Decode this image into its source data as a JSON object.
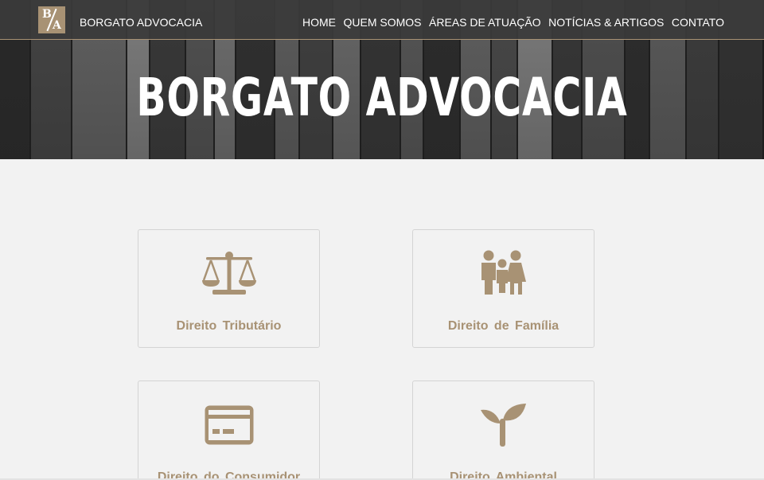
{
  "header": {
    "brand": "BORGATO ADVOCACIA",
    "logo_letters": {
      "top": "B",
      "bottom": "A"
    },
    "nav": [
      {
        "label": "HOME"
      },
      {
        "label": "QUEM SOMOS"
      },
      {
        "label": "ÁREAS DE ATUAÇÃO"
      },
      {
        "label": "NOTÍCIAS & ARTIGOS"
      },
      {
        "label": "CONTATO"
      }
    ]
  },
  "hero": {
    "title": "BORGATO ADVOCACIA"
  },
  "practice_areas": [
    {
      "label": "Direito Tributário",
      "icon": "scales-icon"
    },
    {
      "label": "Direito de Família",
      "icon": "family-icon"
    },
    {
      "label": "Direito do Consumidor",
      "icon": "credit-card-icon"
    },
    {
      "label": "Direito Ambiental",
      "icon": "sprout-icon"
    }
  ],
  "colors": {
    "accent": "#a89274",
    "navbar": "#3a3a3a",
    "background": "#f2f2f2",
    "card_border": "#d4d4d4"
  }
}
